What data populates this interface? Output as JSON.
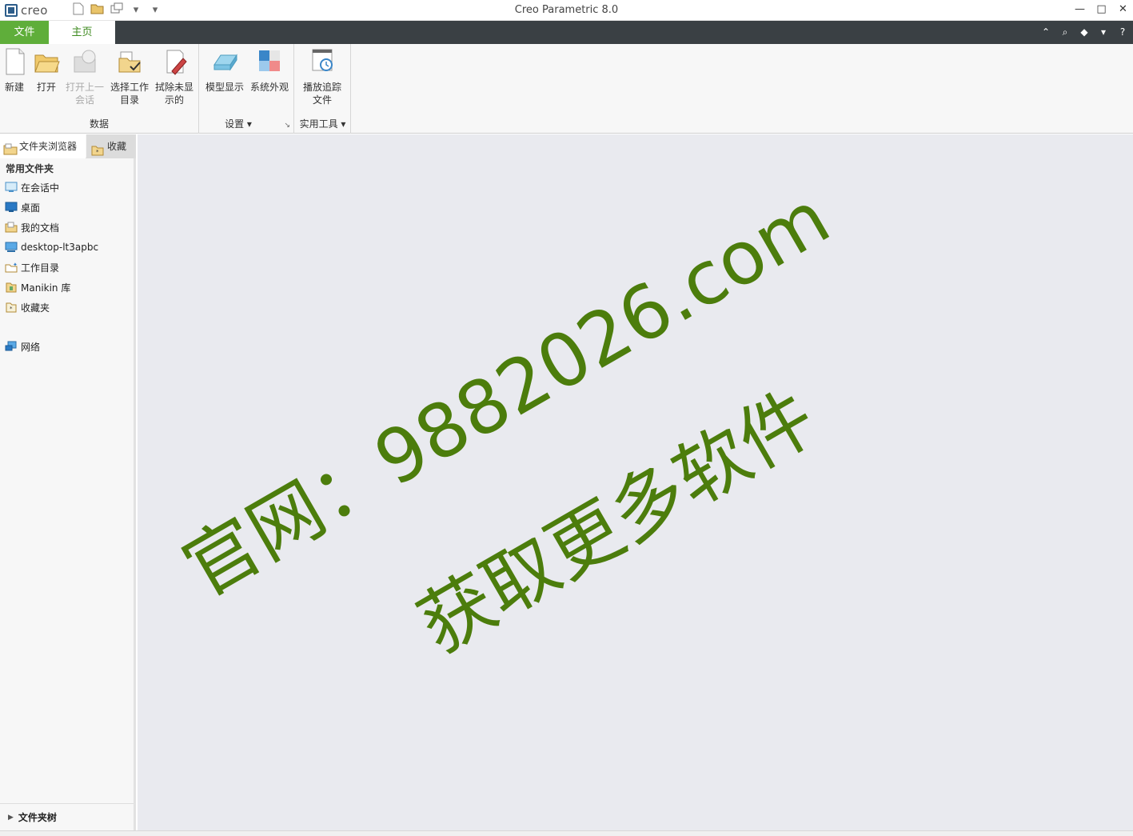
{
  "app": {
    "logo_text": "creo",
    "title": "Creo Parametric 8.0"
  },
  "quick_access": [
    "new-icon",
    "open-icon",
    "windows-icon",
    "dropdown-icon",
    "customize-icon"
  ],
  "window_controls": {
    "minimize": "—",
    "maximize": "□",
    "close": "✕"
  },
  "tabs": {
    "file": "文件",
    "home": "主页"
  },
  "ribbon": {
    "groups": [
      {
        "label": "数据",
        "buttons": [
          {
            "label": "新建",
            "icon": "new-file-icon"
          },
          {
            "label": "打开",
            "icon": "open-folder-icon"
          },
          {
            "label": "打开上一\n会话",
            "icon": "open-last-session-icon",
            "disabled": true
          },
          {
            "label": "选择工作\n目录",
            "icon": "select-working-dir-icon"
          },
          {
            "label": "拭除未显\n示的",
            "icon": "erase-not-displayed-icon"
          }
        ]
      },
      {
        "label": "设置",
        "buttons": [
          {
            "label": "模型显示",
            "icon": "model-display-icon"
          },
          {
            "label": "系统外观",
            "icon": "system-appearance-icon"
          }
        ]
      },
      {
        "label": "实用工具",
        "buttons": [
          {
            "label": "播放追踪\n文件",
            "icon": "play-trail-file-icon"
          }
        ]
      }
    ]
  },
  "sidebar": {
    "tabs": {
      "folder_browser": "文件夹浏览器",
      "favorites": "收藏"
    },
    "common_folders_heading": "常用文件夹",
    "items": [
      {
        "label": "在会话中",
        "icon": "session-icon"
      },
      {
        "label": "桌面",
        "icon": "desktop-icon"
      },
      {
        "label": "我的文档",
        "icon": "documents-icon"
      },
      {
        "label": "desktop-lt3apbc",
        "icon": "computer-icon"
      },
      {
        "label": "工作目录",
        "icon": "working-dir-icon"
      },
      {
        "label": "Manikin 库",
        "icon": "manikin-library-icon"
      },
      {
        "label": "收藏夹",
        "icon": "favorites-icon"
      }
    ],
    "network": "网络",
    "folder_tree": "文件夹树"
  },
  "watermark": {
    "line1": "官网：9882026.com",
    "line2": "获取更多软件"
  },
  "colors": {
    "accent_green": "#5fae3a",
    "tab_bar": "#3a4044",
    "watermark": "#4c7d0c",
    "canvas": "#e9eaef"
  }
}
